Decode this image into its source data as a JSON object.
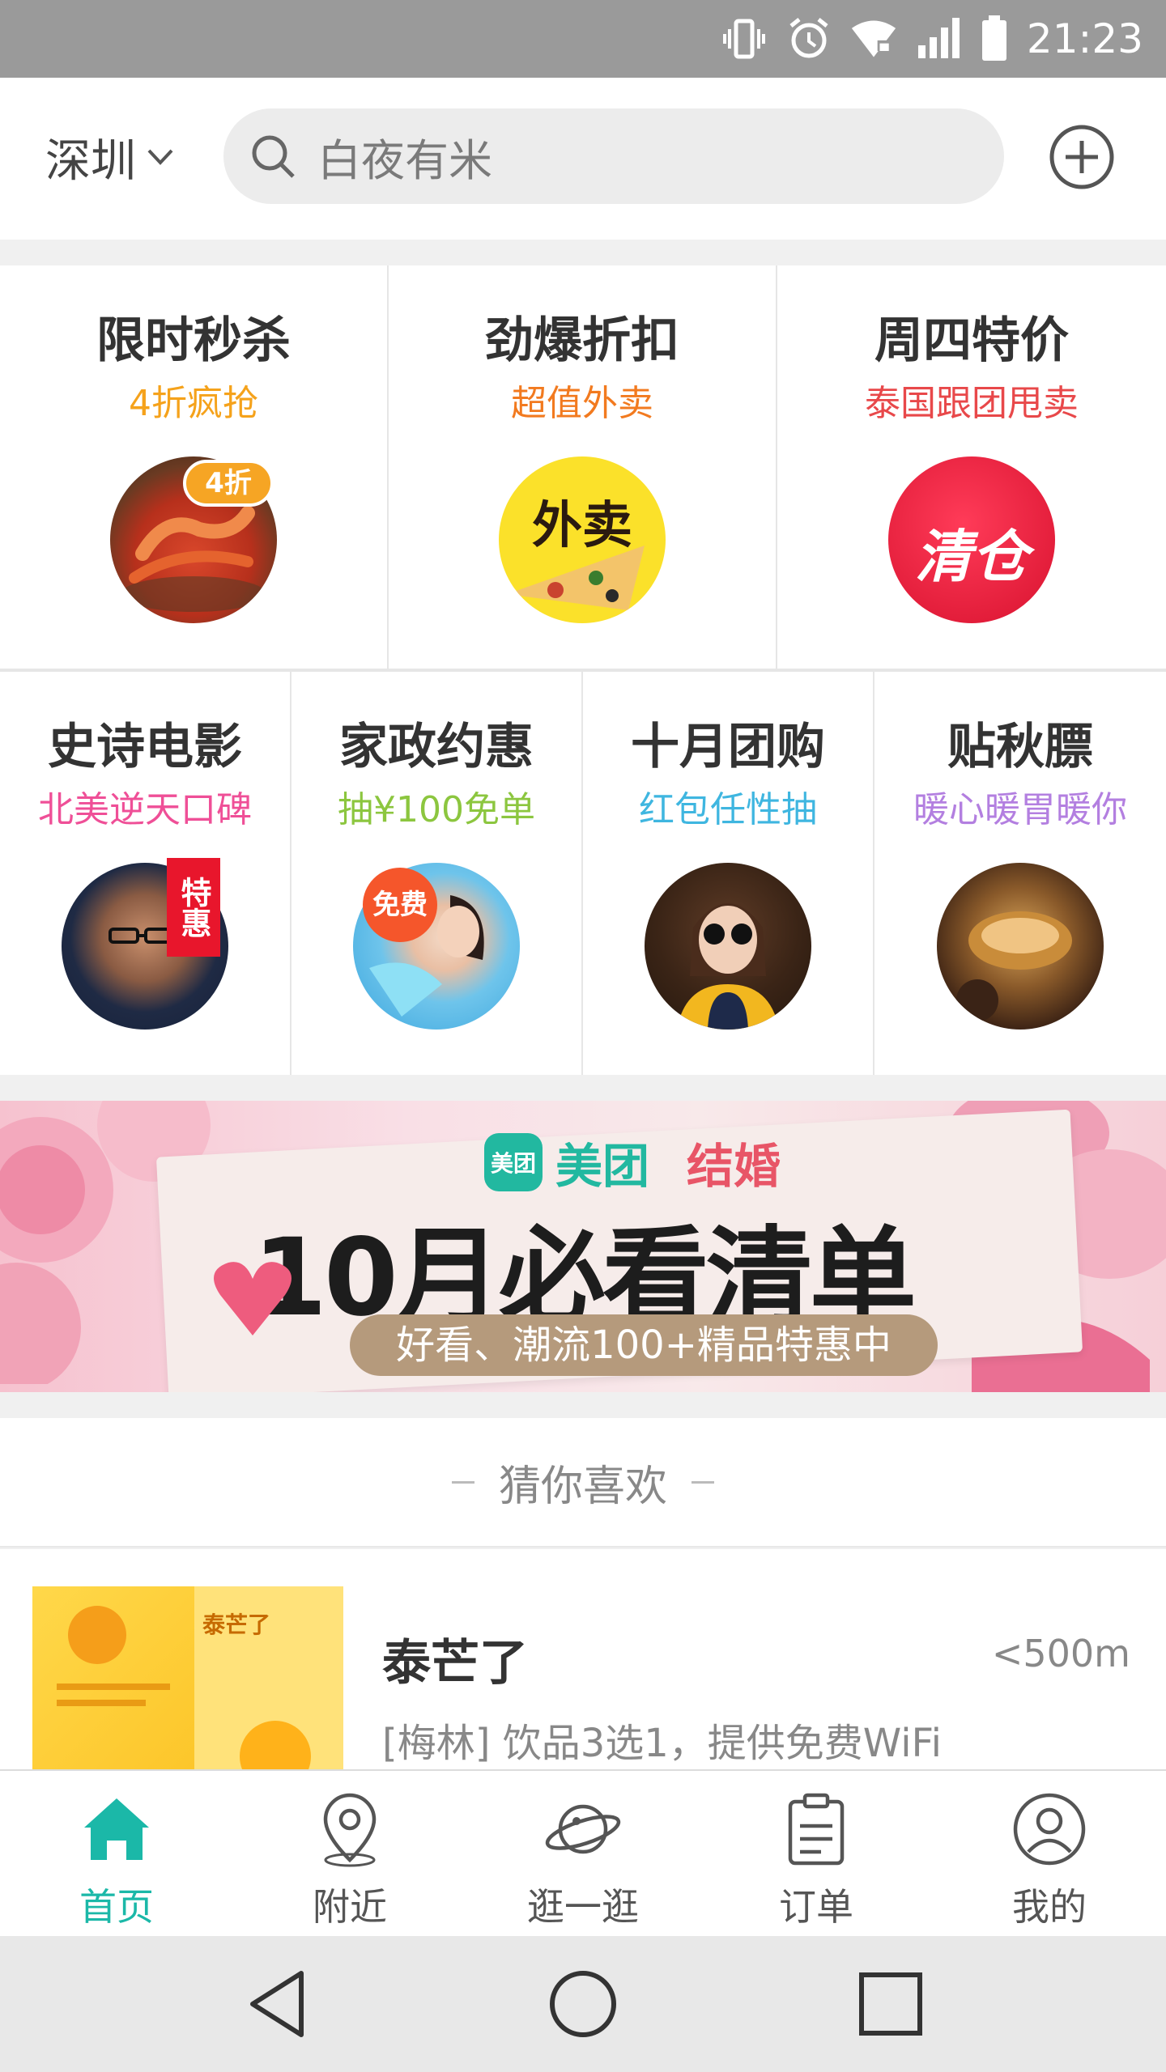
{
  "status_bar": {
    "time": "21:23"
  },
  "header": {
    "city": "深圳",
    "search_placeholder": "白夜有米"
  },
  "promo_row1": [
    {
      "title": "限时秒杀",
      "subtitle": "4折疯抢",
      "subtitle_color": "#f5a21b",
      "badge": "4折"
    },
    {
      "title": "劲爆折扣",
      "subtitle": "超值外卖",
      "subtitle_color": "#f27a1f",
      "badge": "外卖"
    },
    {
      "title": "周四特价",
      "subtitle": "泰国跟团甩卖",
      "subtitle_color": "#e8484a",
      "badge": "清仓"
    }
  ],
  "promo_row2": [
    {
      "title": "史诗电影",
      "subtitle": "北美逆天口碑",
      "subtitle_color": "#ef4f97",
      "badge": "特惠"
    },
    {
      "title": "家政约惠",
      "subtitle": "抽¥100免单",
      "subtitle_color": "#8cc63f",
      "badge": "免费"
    },
    {
      "title": "十月团购",
      "subtitle": "红包任性抽",
      "subtitle_color": "#3fb6e0"
    },
    {
      "title": "贴秋膘",
      "subtitle": "暖心暖胃暖你",
      "subtitle_color": "#b37fe0"
    }
  ],
  "banner": {
    "logo_mark": "美团",
    "brand": "美团",
    "category": "结婚",
    "title": "10月必看清单",
    "pill": "好看、潮流100+精品特惠中"
  },
  "recommend": {
    "heading": "猜你喜欢",
    "items": [
      {
        "name": "泰芒了",
        "distance": "<500m",
        "desc": "[梅林] 饮品3选1，提供免费WiFi",
        "thumb_text": "泰芒了"
      }
    ]
  },
  "tabs": [
    {
      "label": "首页",
      "icon": "home-icon",
      "active": true
    },
    {
      "label": "附近",
      "icon": "location-pin-icon",
      "active": false
    },
    {
      "label": "逛一逛",
      "icon": "planet-icon",
      "active": false
    },
    {
      "label": "订单",
      "icon": "clipboard-icon",
      "active": false
    },
    {
      "label": "我的",
      "icon": "user-icon",
      "active": false
    }
  ],
  "colors": {
    "accent": "#1bb8a8",
    "status_bar": "#9a9a9a"
  }
}
